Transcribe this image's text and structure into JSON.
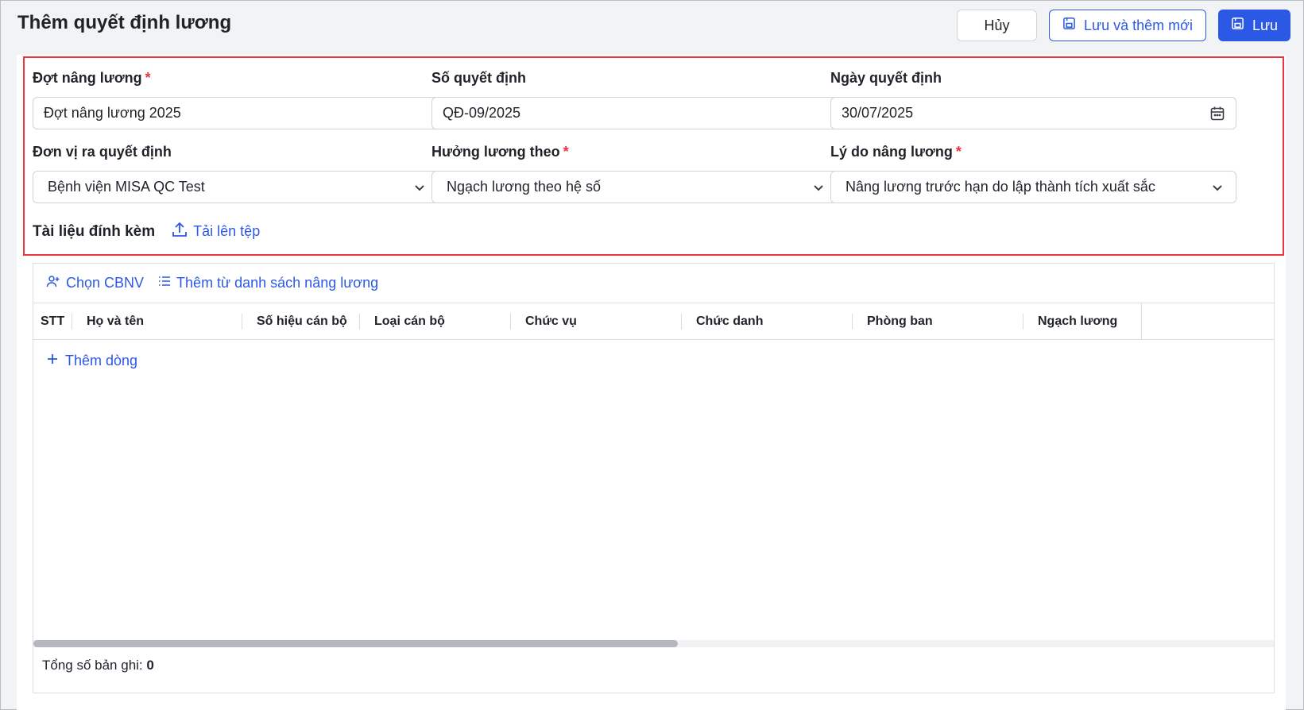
{
  "header": {
    "title": "Thêm quyết định lương",
    "cancel_label": "Hủy",
    "save_new_label": "Lưu và thêm mới",
    "save_label": "Lưu"
  },
  "form": {
    "fields": [
      {
        "label": "Đợt nâng lương",
        "required": "*",
        "value": "Đợt nâng lương 2025",
        "type": "text"
      },
      {
        "label": "Số quyết định",
        "required": "",
        "value": "QĐ-09/2025",
        "type": "text"
      },
      {
        "label": "Ngày quyết định",
        "required": "",
        "value": "30/07/2025",
        "type": "date"
      },
      {
        "label": "Đơn vị ra quyết định",
        "required": "",
        "value": "Bệnh viện MISA QC Test",
        "type": "select"
      },
      {
        "label": "Hưởng lương theo",
        "required": "*",
        "value": "Ngạch lương theo hệ số",
        "type": "select"
      },
      {
        "label": "Lý do nâng lương",
        "required": "*",
        "value": "Nâng lương trước hạn do lập thành tích xuất sắc",
        "type": "select"
      }
    ],
    "attachments_title": "Tài liệu đính kèm",
    "upload_label": "Tải lên tệp"
  },
  "grid": {
    "toolbar": {
      "choose_employee": "Chọn CBNV",
      "add_from_list": "Thêm từ danh sách nâng lương"
    },
    "columns": [
      "STT",
      "Họ và tên",
      "Số hiệu cán bộ",
      "Loại cán bộ",
      "Chức vụ",
      "Chức danh",
      "Phòng ban",
      "Ngạch lương"
    ],
    "add_row_label": "Thêm dòng",
    "total_label": "Tổng số bản ghi:",
    "total_value": "0"
  },
  "icons": {
    "save": "save-icon",
    "calendar": "calendar-icon",
    "chevron": "chevron-down-icon",
    "upload": "upload-icon",
    "add_user": "user-plus-icon",
    "list": "list-icon",
    "plus": "plus-icon"
  },
  "colors": {
    "primary": "#2c58e6",
    "required": "#e8343a",
    "highlight_border": "#e8343a"
  }
}
